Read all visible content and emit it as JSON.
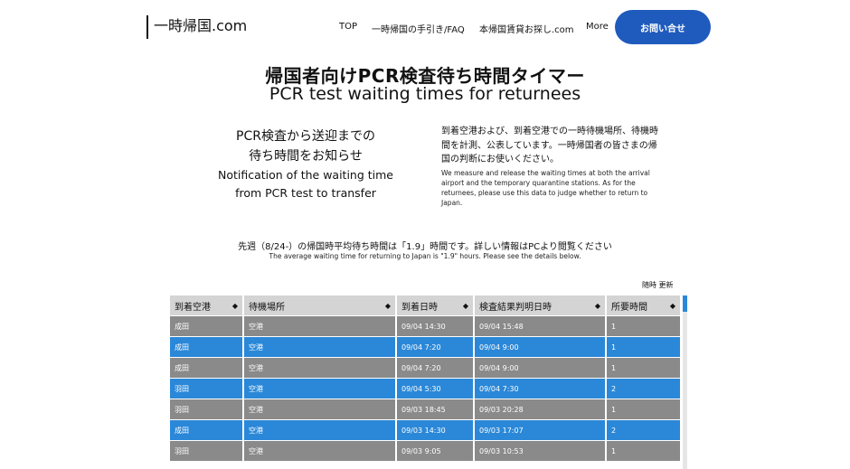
{
  "header": {
    "logo": "一時帰国.com",
    "nav": [
      {
        "label": "TOP"
      },
      {
        "label": "一時帰国の手引き/FAQ"
      },
      {
        "label": "本帰国賃貸お探し.com"
      },
      {
        "label": "More"
      }
    ],
    "contact_label": "お問い合せ"
  },
  "hero": {
    "title_jp": "帰国者向けPCR検査待ち時間タイマー",
    "title_en": "PCR test waiting times for returnees",
    "left": {
      "jp_line1": "PCR検査から送迎までの",
      "jp_line2": "待ち時間をお知らせ",
      "en_line1": "Notification of the waiting time",
      "en_line2": "from PCR test to transfer"
    },
    "right": {
      "jp": "到着空港および、到着空港での一時待機場所、待機時間を計測、公表しています。一時帰国者の皆さまの帰国の判断にお使いください。",
      "en": "We measure and release the waiting times at both the arrival airport and the temporary quarantine stations. As for the returnees, please use this data to judge whether to return to Japan."
    }
  },
  "notice": {
    "jp": "先週（8/24-）の帰国時平均待ち時間は「1.9」時間です。詳しい情報はPCより閲覧ください",
    "en": "The average waiting time for returning to Japan is \"1.9\" hours.  Please see the details below."
  },
  "updated_label": "随時 更新",
  "table": {
    "sort_icon": "◆",
    "headers": [
      "到着空港",
      "待機場所",
      "到着日時",
      "検査結果判明日時",
      "所要時間"
    ],
    "rows": [
      {
        "cells": [
          "成田",
          "空港",
          "09/04 14:30",
          "09/04 15:48",
          "1"
        ],
        "style": "gray"
      },
      {
        "cells": [
          "成田",
          "空港",
          "09/04 7:20",
          "09/04 9:00",
          "1"
        ],
        "style": "blue"
      },
      {
        "cells": [
          "成田",
          "空港",
          "09/04 7:20",
          "09/04 9:00",
          "1"
        ],
        "style": "gray"
      },
      {
        "cells": [
          "羽田",
          "空港",
          "09/04 5:30",
          "09/04 7:30",
          "2"
        ],
        "style": "blue"
      },
      {
        "cells": [
          "羽田",
          "空港",
          "09/03 18:45",
          "09/03 20:28",
          "1"
        ],
        "style": "gray"
      },
      {
        "cells": [
          "成田",
          "空港",
          "09/03 14:30",
          "09/03 17:07",
          "2"
        ],
        "style": "blue"
      },
      {
        "cells": [
          "羽田",
          "空港",
          "09/03 9:05",
          "09/03 10:53",
          "1"
        ],
        "style": "gray"
      }
    ]
  },
  "colors": {
    "accent": "#1f5bbd",
    "row_blue": "#2b88d8",
    "row_gray": "#8a8a8a",
    "header_gray": "#d4d4d4"
  }
}
